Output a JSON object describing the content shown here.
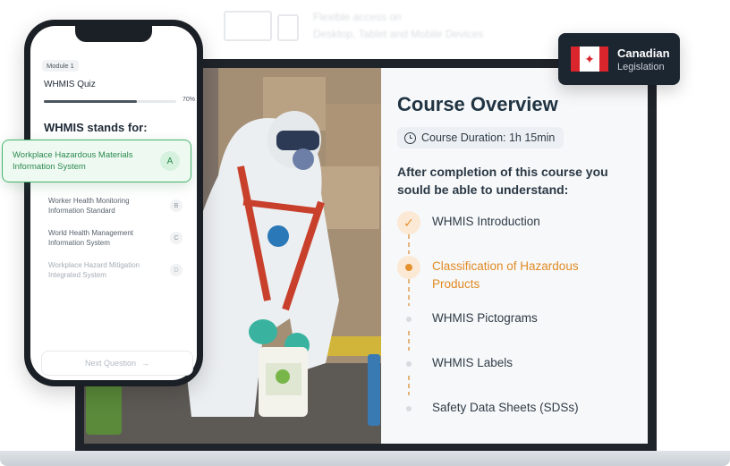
{
  "colors": {
    "accent_orange": "#e5922e",
    "success_green": "#47b46d",
    "course_title": "#1f3342",
    "badge_bg": "#1c2631",
    "flag_red": "#d9252b"
  },
  "hint": {
    "line1": "Flexible access on",
    "line2": "Desktop, Tablet and Mobile Devices"
  },
  "badge": {
    "title": "Canadian",
    "subtitle": "Legislation",
    "flag_icon": "maple-leaf-icon",
    "leaf_glyph": "✦"
  },
  "course": {
    "title": "Course Overview",
    "duration": "Course Duration: 1h 15min",
    "after_line1": "After completion of this course you",
    "after_line2": "sould be able to understand:",
    "topics": [
      {
        "label": "WHMIS Introduction",
        "state": "done",
        "mark": "✓"
      },
      {
        "label_line1": "Classification of Hazardous",
        "label_line2": "Products",
        "state": "active"
      },
      {
        "label": "WHMIS Pictograms",
        "state": "pending"
      },
      {
        "label": "WHMIS Labels",
        "state": "pending"
      },
      {
        "label": "Safety Data Sheets (SDSs)",
        "state": "pending"
      }
    ]
  },
  "quiz": {
    "module": "Module 1",
    "title": "WHMIS Quiz",
    "progress_percent": 70,
    "progress_label": "70%",
    "question": "WHMIS stands for:",
    "options": [
      {
        "line1": "Workplace Hazardous Materials",
        "line2": "Information System",
        "letter": "A",
        "selected": true
      },
      {
        "line1": "Worker Health Monitoring",
        "line2": "Information Standard",
        "letter": "B"
      },
      {
        "line1": "World Health Management",
        "line2": "Information System",
        "letter": "C"
      },
      {
        "line1": "Workplace Hazard Mitigation",
        "line2": "Integrated System",
        "letter": "D"
      }
    ],
    "next_label": "Next Question",
    "next_arrow": "→"
  }
}
